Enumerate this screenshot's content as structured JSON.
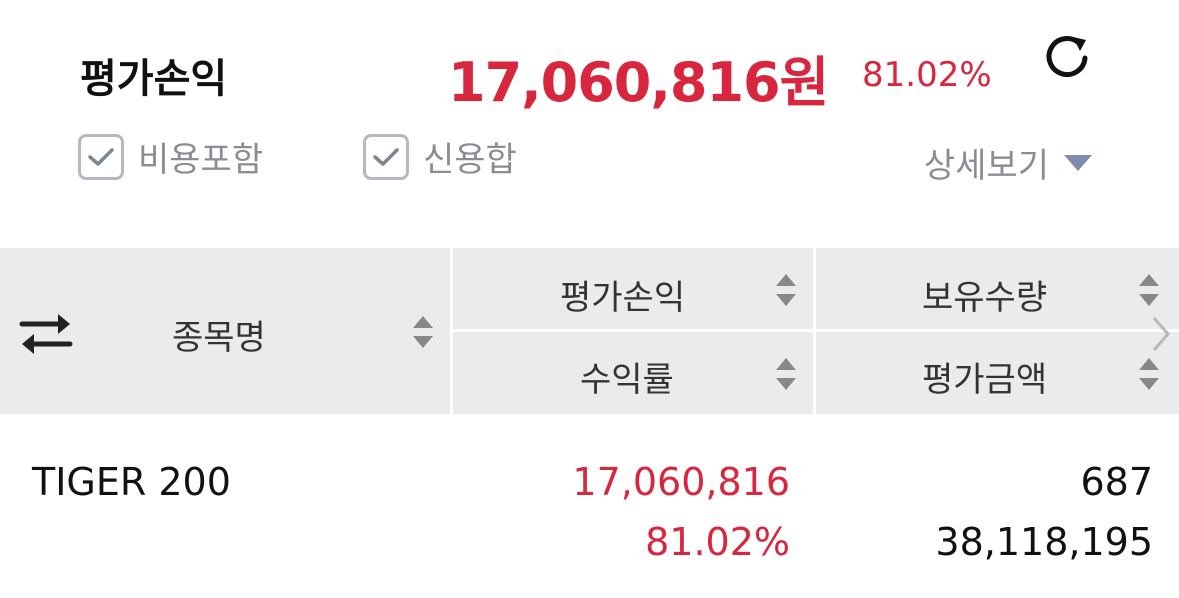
{
  "summary": {
    "label": "평가손익",
    "amount": "17,060,816원",
    "rate": "81.02%",
    "colors": {
      "profit": "#d7263d"
    }
  },
  "options": {
    "include_fees": {
      "label": "비용포함",
      "checked": true
    },
    "credit_sum": {
      "label": "신용합",
      "checked": true
    },
    "detail_label": "상세보기"
  },
  "table": {
    "headers": {
      "name": "종목명",
      "pnl": "평가손익",
      "rate": "수익률",
      "qty": "보유수량",
      "value": "평가금액"
    },
    "rows": [
      {
        "name": "TIGER 200",
        "pnl": "17,060,816",
        "rate": "81.02%",
        "qty": "687",
        "value": "38,118,195"
      }
    ]
  },
  "icons": {
    "refresh": "refresh-icon",
    "checkbox": "check-icon",
    "dropdown": "caret-down-icon",
    "sort": "sort-updown-icon",
    "column_toggle": "swap-arrows-icon",
    "next": "chevron-right-icon"
  }
}
